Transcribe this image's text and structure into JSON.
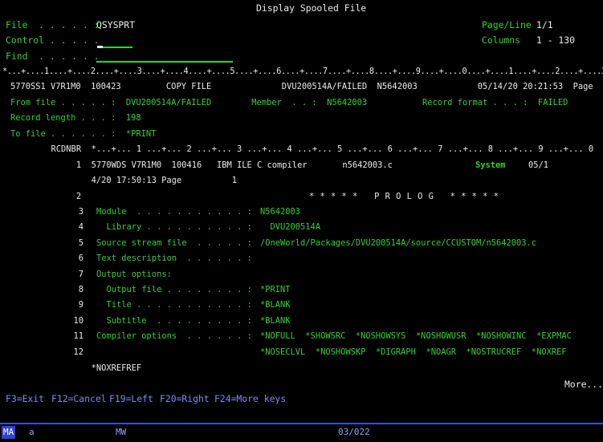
{
  "title": "Display Spooled File",
  "header": {
    "file_label": "File  . . . . . :",
    "file_value": "QSYSPRT",
    "control_label": "Control . . . . .",
    "find_label": "Find  . . . . . .",
    "page_line_label": "Page/Line",
    "page_line_value": "1/1",
    "columns_label": "Columns",
    "columns_value": "1 - 130"
  },
  "ruler": "*...+....1....+....2....+....3....+....4....+....5....+....6....+....7....+....8....+....9....+....0....+....1....+....2....+....3",
  "spool": {
    "line1": "5770SS1 V7R1M0  100423         COPY FILE              DVU200514A/FAILED  N5642003            05/14/20 20:21:53  Page",
    "from_file": "From file . . . . . :  DVU200514A/FAILED        Member  . . :  N5642003           Record format . . . :  FAILED",
    "record_length": "Record length . . . :  198",
    "to_file": "To file . . . . . . :  *PRINT",
    "rcdnbr_header": "      RCDNBR  *...+... 1 ...+... 2 ...+... 3 ...+... 4 ...+... 5 ...+... 6 ...+... 7 ...+... 8 ...+... 9 ...+... 0",
    "rec1_a": "           1  5770WDS V7R1M0  100416   IBM ILE C compiler       n5642003.c",
    "rec1_system": "System",
    "rec1_b": "05/1",
    "rec1_cont": "              4/20 17:50:13 Page          1",
    "rec2_num": "           2",
    "rec2_text": "* * * * *   P R O L O G   * * * * *",
    "rows": [
      {
        "num": "3",
        "label": "Module  . . . . . . . . . . . :",
        "value": "N5642003"
      },
      {
        "num": "4",
        "label": "  Library . . . . . . . . . . :",
        "value": "  DVU200514A"
      },
      {
        "num": "5",
        "label": "Source stream file  . . . . . :",
        "value": "/OneWorld/Packages/DVU200514A/source/CCUSTOM/n5642003.c"
      },
      {
        "num": "6",
        "label": "Text description  . . . . . . :",
        "value": ""
      },
      {
        "num": "7",
        "label": "Output options:",
        "value": ""
      },
      {
        "num": "8",
        "label": "  Output file . . . . . . . . :",
        "value": "*PRINT"
      },
      {
        "num": "9",
        "label": "  Title . . . . . . . . . . . :",
        "value": "*BLANK"
      },
      {
        "num": "10",
        "label": "  Subtitle  . . . . . . . . . :",
        "value": "*BLANK"
      },
      {
        "num": "11",
        "label": "Compiler options  . . . . . . :",
        "value": "*NOFULL  *SHOWSRC  *NOSHOWSYS  *NOSHOWUSR  *NOSHOWINC  *EXPMAC"
      },
      {
        "num": "12",
        "label": "",
        "value": "*NOSECLVL  *NOSHOWSKP  *DIGRAPH  *NOAGR  *NOSTRUCREF  *NOXREF"
      }
    ],
    "rec_cont2": "              *NOXREFREF"
  },
  "more": "More...",
  "fkeys": {
    "f3": "F3=Exit",
    "f12": "F12=Cancel",
    "f19": "F19=Left",
    "f20": "F20=Right",
    "f24": "F24=More keys"
  },
  "statusbar": {
    "ma": "MA",
    "a": "a",
    "mw": "MW",
    "pos": "03/022"
  },
  "colors": {
    "green": "#33d233",
    "white": "#ececec",
    "blue": "#7b8cf2"
  }
}
